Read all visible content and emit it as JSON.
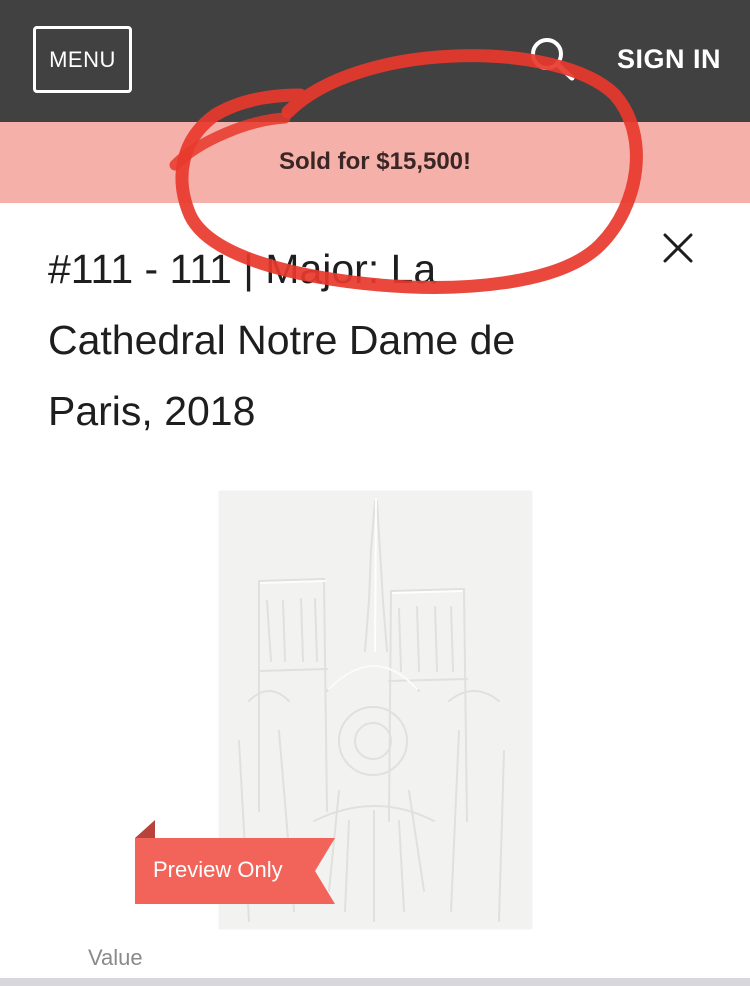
{
  "header": {
    "menu_label": "MENU",
    "search_icon": "search-icon",
    "sign_in_label": "SIGN IN",
    "background_color": "#414141"
  },
  "banner": {
    "sold_text": "Sold for $15,500!",
    "background_color": "#f6b0aa"
  },
  "lot": {
    "title_line1": "#111 - 111 | Major: La",
    "title_line2": "Cathedral Notre Dame de",
    "title_line3": "Paris, 2018",
    "close_icon": "close-icon"
  },
  "artwork": {
    "ribbon_label": "Preview Only",
    "ribbon_color": "#f2645a"
  },
  "details": {
    "value_label": "Value"
  },
  "annotation": {
    "color": "#e8382c"
  }
}
